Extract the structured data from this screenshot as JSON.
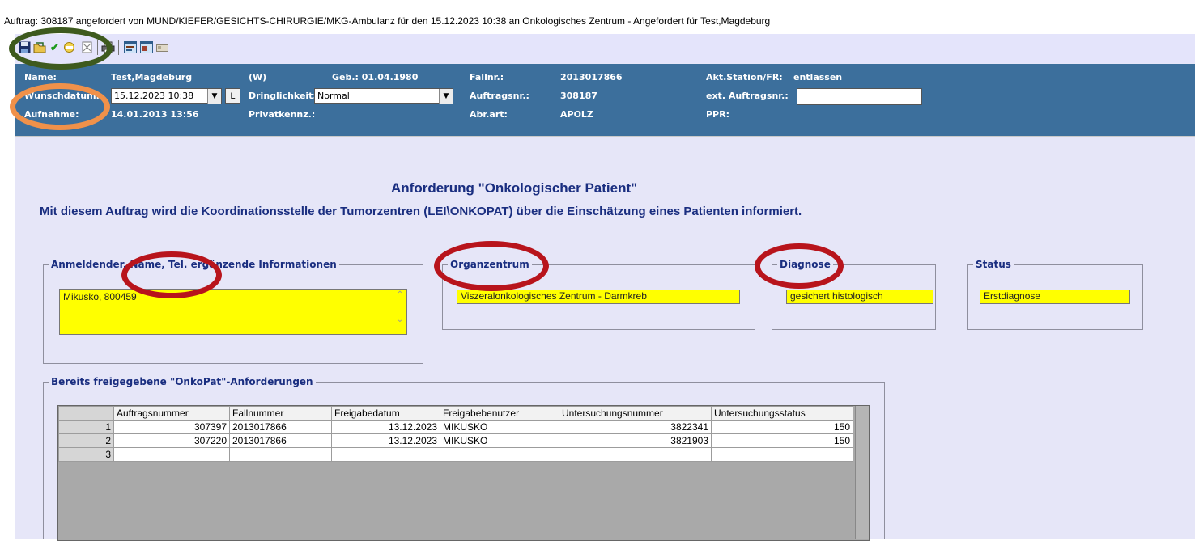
{
  "window_title": "Auftrag: 308187 angefordert von MUND/KIEFER/GESICHTS-CHIRURGIE/MKG-Ambulanz für den 15.12.2023 10:38 an Onkologisches Zentrum - Angefordert für Test,Magdeburg",
  "toolbar": {
    "icons": [
      "save-icon",
      "open-folder-icon",
      "checkmark-icon",
      "clear-icon",
      "cancel-doc-icon",
      "print-icon",
      "form-icon",
      "form-sign-icon",
      "id-card-icon"
    ]
  },
  "header": {
    "name_label": "Name:",
    "name_value": "Test,Magdeburg",
    "sex": "(W)",
    "birth": "Geb.: 01.04.1980",
    "fallnr_label": "Fallnr.:",
    "fallnr_value": "2013017866",
    "station_label": "Akt.Station/FR:",
    "station_value": "entlassen",
    "wunsch_label": "Wunschdatum:",
    "wunsch_value": "15.12.2023 10:38",
    "l_button": "L",
    "dring_label": "Dringlichkeit:",
    "dring_value": "Normal",
    "auftragsnr_label": "Auftragsnr.:",
    "auftragsnr_value": "308187",
    "ext_label": "ext. Auftragsnr.:",
    "ext_value": "",
    "aufnahme_label": "Aufnahme:",
    "aufnahme_value": "14.01.2013 13:56",
    "privat_label": "Privatkennz.:",
    "abrart_label": "Abr.art:",
    "abrart_value": "APOLZ",
    "ppr_label": "PPR:"
  },
  "form": {
    "title": "Anforderung \"Onkologischer Patient\"",
    "subtitle": "Mit diesem Auftrag wird die Koordinationsstelle der Tumorzentren (LEI\\ONKOPAT) über die Einschätzung eines Patienten informiert.",
    "anmeldender_legend": "Anmeldender, Name, Tel. ergänzende Informationen",
    "anmeldender_value": "Mikusko, 800459",
    "organ_legend": "Organzentrum",
    "organ_value": "Viszeralonkologisches Zentrum - Darmkreb",
    "diagnose_legend": "Diagnose",
    "diagnose_value": "gesichert histologisch",
    "status_legend": "Status",
    "status_value": "Erstdiagnose",
    "released_legend": "Bereits freigegebene \"OnkoPat\"-Anforderungen"
  },
  "table": {
    "headers": [
      "Auftragsnummer",
      "Fallnummer",
      "Freigabedatum",
      "Freigabebenutzer",
      "Untersuchungsnummer",
      "Untersuchungsstatus"
    ],
    "rows": [
      {
        "n": "1",
        "cells": [
          "307397",
          "2013017866",
          "13.12.2023",
          "MIKUSKO",
          "3822341",
          "150"
        ]
      },
      {
        "n": "2",
        "cells": [
          "307220",
          "2013017866",
          "13.12.2023",
          "MIKUSKO",
          "3821903",
          "150"
        ]
      },
      {
        "n": "3",
        "cells": [
          "",
          "",
          "",
          "",
          "",
          ""
        ]
      }
    ]
  },
  "annotation_colors": {
    "green": "#3e5a1e",
    "orange": "#f0914a",
    "red": "#b8141c"
  }
}
